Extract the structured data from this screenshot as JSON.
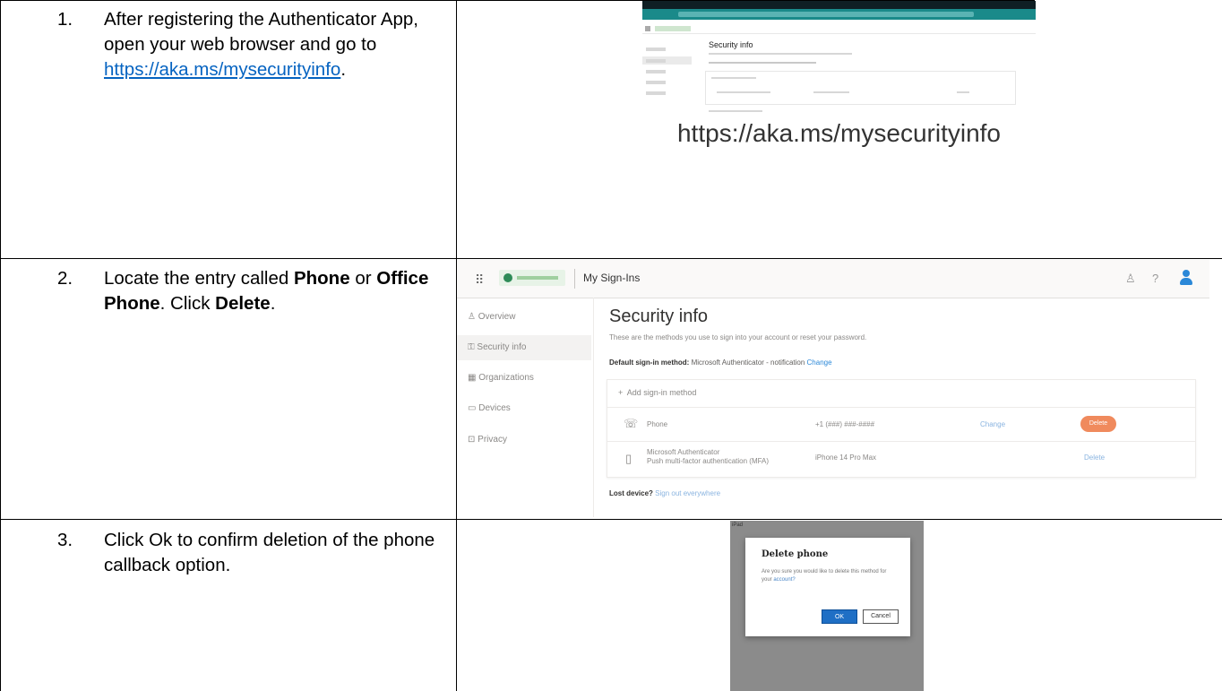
{
  "steps": [
    {
      "number": "1.",
      "text_before": "After registering the Authenticator App, open your web browser and go to ",
      "link": "https://aka.ms/mysecurityinfo",
      "text_after": "."
    },
    {
      "number": "2.",
      "t1": "Locate the entry called ",
      "b1": "Phone",
      "t2": " or ",
      "b2": "Office Phone",
      "t3": ". Click ",
      "b3": "Delete",
      "t4": "."
    },
    {
      "number": "3.",
      "text": "Click Ok to confirm deletion of the phone callback option."
    }
  ],
  "screenshot1": {
    "page_title": "Security info",
    "caption": "https://aka.ms/mysecurityinfo"
  },
  "screenshot2": {
    "app_title": "My Sign-Ins",
    "header_icons": [
      "org-icon",
      "help-icon",
      "avatar-icon"
    ],
    "nav": [
      {
        "icon": "person-icon",
        "glyph": "♙",
        "label": "Overview"
      },
      {
        "icon": "key-icon",
        "glyph": "⚿",
        "label": "Security info"
      },
      {
        "icon": "building-icon",
        "glyph": "▦",
        "label": "Organizations"
      },
      {
        "icon": "laptop-icon",
        "glyph": "▭",
        "label": "Devices"
      },
      {
        "icon": "lock-icon",
        "glyph": "⊡",
        "label": "Privacy"
      }
    ],
    "title": "Security info",
    "description": "These are the methods you use to sign into your account or reset your password.",
    "default_label": "Default sign-in method:",
    "default_value": "Microsoft Authenticator - notification",
    "default_change": "Change",
    "add_method": "Add sign-in method",
    "methods": [
      {
        "icon": "phone-icon",
        "name": "Phone",
        "detail": "+1 (###) ###-####",
        "action1": "Change",
        "action2": "Delete"
      },
      {
        "icon": "authenticator-icon",
        "name": "Microsoft Authenticator",
        "subname": "Push multi-factor authentication (MFA)",
        "detail": "iPhone 14 Pro Max",
        "action1": "Delete"
      }
    ],
    "lost_label": "Lost device?",
    "lost_link": "Sign out everywhere"
  },
  "screenshot3": {
    "corner_label": "iPad",
    "dialog_title": "Delete phone",
    "message_before": "Are you sure you would like to delete this method for your ",
    "message_link": "account?",
    "ok_label": "OK",
    "cancel_label": "Cancel"
  },
  "colors": {
    "link_blue": "#0563c1",
    "delete_orange": "#f08a5d",
    "ok_blue": "#1f6fc5",
    "teal": "#1a8a8a"
  }
}
